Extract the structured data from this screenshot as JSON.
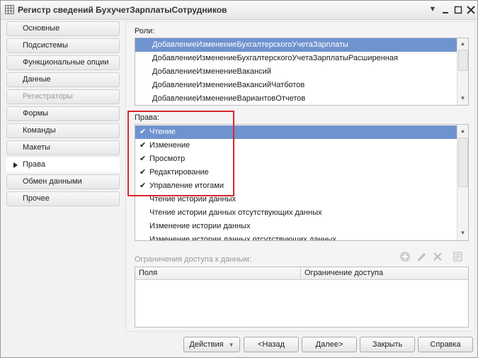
{
  "window": {
    "title": "Регистр сведений БухучетЗарплатыСотрудников"
  },
  "titlebar_icons": {
    "menu": "dropdown-menu-icon",
    "minimize": "minimize-icon",
    "maximize": "maximize-icon",
    "close": "close-icon"
  },
  "nav": {
    "items": [
      {
        "label": "Основные",
        "state": "normal"
      },
      {
        "label": "Подсистемы",
        "state": "normal"
      },
      {
        "label": "Функциональные опции",
        "state": "normal"
      },
      {
        "label": "Данные",
        "state": "normal"
      },
      {
        "label": "Регистраторы",
        "state": "disabled"
      },
      {
        "label": "Формы",
        "state": "normal"
      },
      {
        "label": "Команды",
        "state": "normal"
      },
      {
        "label": "Макеты",
        "state": "normal"
      },
      {
        "label": "Права",
        "state": "active"
      },
      {
        "label": "Обмен данными",
        "state": "normal"
      },
      {
        "label": "Прочее",
        "state": "normal"
      }
    ]
  },
  "roles": {
    "label": "Роли:",
    "items": [
      "ДобавлениеИзменениеБухгалтерскогоУчетаЗарплаты",
      "ДобавлениеИзменениеБухгалтерскогоУчетаЗарплатыРасширенная",
      "ДобавлениеИзменениеВакансий",
      "ДобавлениеИзменениеВакансийЧатботов",
      "ДобавлениеИзменениеВариантовОтчетов"
    ],
    "selected_index": 0
  },
  "rights": {
    "label": "Права:",
    "items": [
      {
        "label": "Чтение",
        "checked": true
      },
      {
        "label": "Изменение",
        "checked": true
      },
      {
        "label": "Просмотр",
        "checked": true
      },
      {
        "label": "Редактирование",
        "checked": true
      },
      {
        "label": "Управление итогами",
        "checked": true
      },
      {
        "label": "Чтение истории данных",
        "checked": false
      },
      {
        "label": "Чтение истории данных отсутствующих данных",
        "checked": false
      },
      {
        "label": "Изменение истории данных",
        "checked": false
      },
      {
        "label": "Изменение истории данных отсутствующих данных",
        "checked": false
      }
    ],
    "selected_index": 0,
    "highlight_color": "#d9262c"
  },
  "restrictions": {
    "label": "Ограничения доступа к данным:",
    "columns": [
      "Поля",
      "Ограничение доступа"
    ],
    "toolbar_icons": [
      "add-icon",
      "edit-icon",
      "delete-icon",
      "text-editor-icon"
    ]
  },
  "buttons": {
    "actions": "Действия",
    "back": "<Назад",
    "next": "Далее>",
    "close": "Закрыть",
    "help": "Справка"
  }
}
